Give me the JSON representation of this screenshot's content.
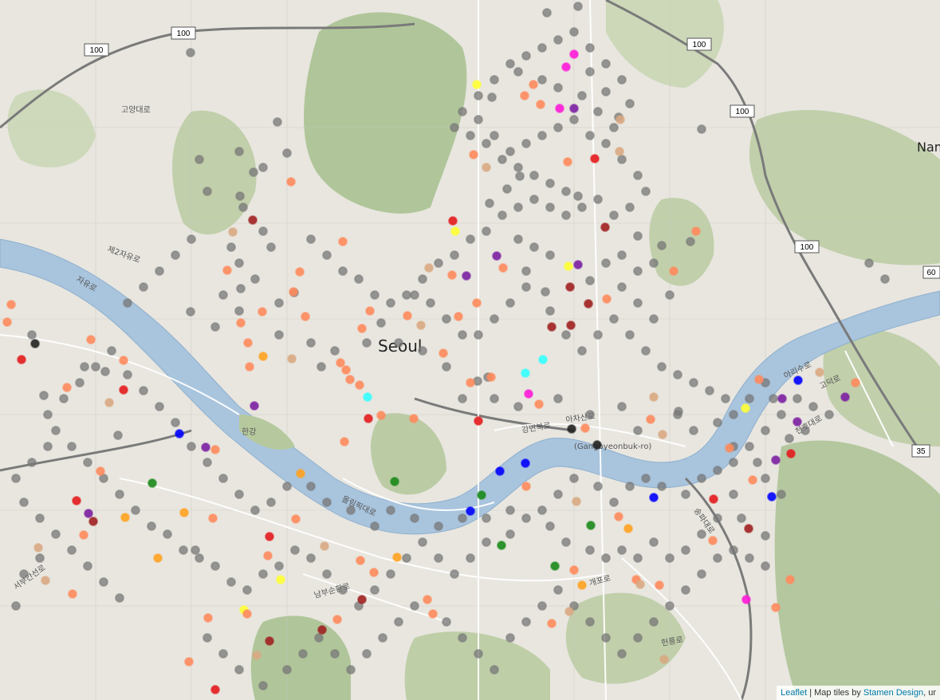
{
  "map": {
    "city_label": "Seoul",
    "edge_label": "Nam",
    "river_label": "한강",
    "route_shields": [
      "100",
      "100",
      "100",
      "100",
      "100",
      "60",
      "35"
    ],
    "road_labels": [
      "고양대로",
      "제2자유로",
      "자유로",
      "올림픽대로",
      "강변북로",
      "(Gangbyeonbuk-ro)",
      "아차산로",
      "아리수로",
      "고덕로",
      "천호대로",
      "남부순환로",
      "개포로",
      "헌릉로",
      "송파대로",
      "서부간선로"
    ],
    "colors": {
      "water": "#a9c4dd",
      "land": "#e8e6df",
      "park": "#b9cc9a",
      "mountain": "#8fae7a",
      "road": "#ffffff",
      "expressway": "#6b6b6b"
    },
    "marker_colors": {
      "gray": "#777777",
      "light_orange": "#ff8a5c",
      "tan": "#d9a982",
      "red": "#e31a1c",
      "dark_red": "#a02020",
      "orange": "#ffa21f",
      "yellow": "#ffff33",
      "purple": "#7b1fa2",
      "magenta": "#ff1ad9",
      "cyan": "#33ffff",
      "blue": "#0000ff",
      "green": "#1a8a1a",
      "black": "#222222"
    }
  },
  "markers": [
    {
      "c": "gray",
      "lat": 37.6,
      "lng": 126.9
    },
    {
      "c": "red",
      "lat": 37.61,
      "lng": 126.98
    },
    {
      "c": "yellow",
      "lat": 37.605,
      "lng": 126.99
    }
  ],
  "attribution": {
    "leaflet": "Leaflet",
    "separator": " | Map tiles by ",
    "stamen": "Stamen Design",
    "suffix": ", ur"
  }
}
